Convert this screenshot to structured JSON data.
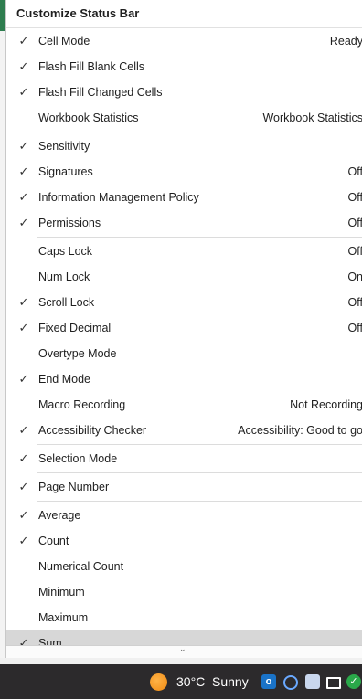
{
  "menu": {
    "title": "Customize Status Bar",
    "groups": [
      {
        "items": [
          {
            "check": "✓",
            "label": "Cell Mode",
            "value": "Ready"
          },
          {
            "check": "✓",
            "label": "Flash Fill Blank Cells",
            "value": ""
          },
          {
            "check": "✓",
            "label": "Flash Fill Changed Cells",
            "value": ""
          },
          {
            "check": "",
            "label": "Workbook Statistics",
            "value": "Workbook Statistics"
          }
        ]
      },
      {
        "items": [
          {
            "check": "✓",
            "label": "Sensitivity",
            "value": ""
          },
          {
            "check": "✓",
            "label": "Signatures",
            "value": "Off"
          },
          {
            "check": "✓",
            "label": "Information Management Policy",
            "value": "Off"
          },
          {
            "check": "✓",
            "label": "Permissions",
            "value": "Off"
          }
        ]
      },
      {
        "items": [
          {
            "check": "",
            "label": "Caps Lock",
            "value": "Off"
          },
          {
            "check": "",
            "label": "Num Lock",
            "value": "On"
          },
          {
            "check": "✓",
            "label": "Scroll Lock",
            "value": "Off"
          },
          {
            "check": "✓",
            "label": "Fixed Decimal",
            "value": "Off"
          },
          {
            "check": "",
            "label": "Overtype Mode",
            "value": ""
          },
          {
            "check": "✓",
            "label": "End Mode",
            "value": ""
          },
          {
            "check": "",
            "label": "Macro Recording",
            "value": "Not Recording"
          },
          {
            "check": "✓",
            "label": "Accessibility Checker",
            "value": "Accessibility: Good to go"
          }
        ]
      },
      {
        "items": [
          {
            "check": "✓",
            "label": "Selection Mode",
            "value": ""
          }
        ]
      },
      {
        "items": [
          {
            "check": "✓",
            "label": "Page Number",
            "value": ""
          }
        ]
      },
      {
        "items": [
          {
            "check": "✓",
            "label": "Average",
            "value": ""
          },
          {
            "check": "✓",
            "label": "Count",
            "value": ""
          },
          {
            "check": "",
            "label": "Numerical Count",
            "value": ""
          },
          {
            "check": "",
            "label": "Minimum",
            "value": ""
          },
          {
            "check": "",
            "label": "Maximum",
            "value": ""
          },
          {
            "check": "✓",
            "label": "Sum",
            "value": ""
          }
        ]
      }
    ],
    "scroll_arrow": "⌄"
  },
  "taskbar": {
    "temperature": "30°C",
    "condition": "Sunny",
    "weather_icon": "sun-icon",
    "tray_icons": [
      "outlook-icon",
      "edge-icon",
      "network-icon",
      "mail-icon",
      "green-check-icon"
    ]
  }
}
